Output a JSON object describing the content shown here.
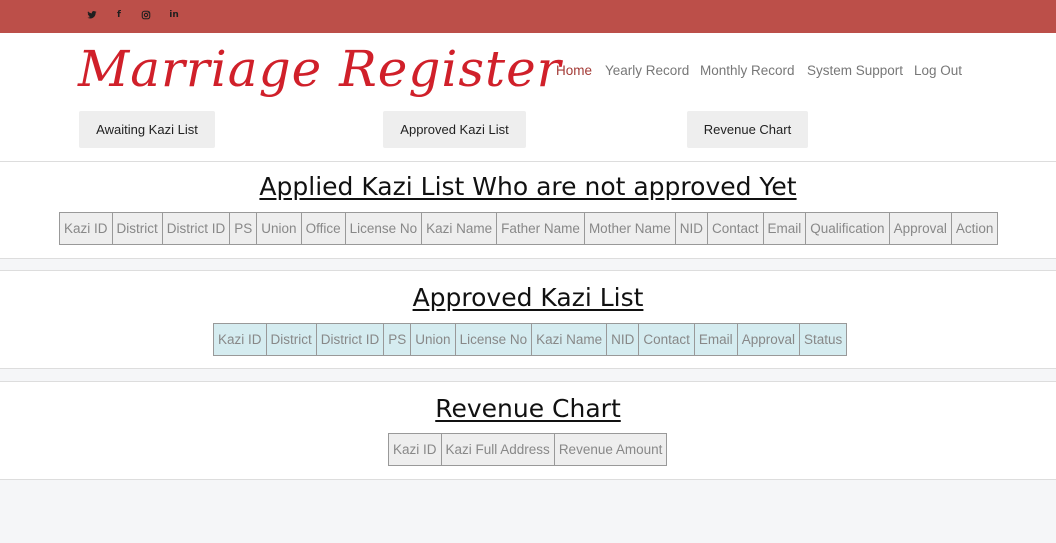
{
  "social": {
    "twitter": "twitter-icon",
    "facebook": "f",
    "instagram": "instagram-icon",
    "linkedin": "in"
  },
  "brand": {
    "logo_text": "Marriage Register"
  },
  "nav": {
    "home": "Home",
    "yearly": "Yearly Record",
    "monthly": "Monthly Record",
    "support": "System Support",
    "logout": "Log Out"
  },
  "buttons": {
    "awaiting": "Awaiting Kazi List",
    "approved": "Approved Kazi List",
    "revenue": "Revenue Chart"
  },
  "applied": {
    "title": "Applied Kazi List Who are not approved Yet",
    "columns": [
      "Kazi ID",
      "District",
      "District ID",
      "PS",
      "Union",
      "Office",
      "License No",
      "Kazi Name",
      "Father Name",
      "Mother Name",
      "NID",
      "Contact",
      "Email",
      "Qualification",
      "Approval",
      "Action"
    ]
  },
  "approved": {
    "title": "Approved Kazi List",
    "columns": [
      "Kazi ID",
      "District",
      "District ID",
      "PS",
      "Union",
      "License No",
      "Kazi Name",
      "NID",
      "Contact",
      "Email",
      "Approval",
      "Status"
    ]
  },
  "revenue": {
    "title": "Revenue Chart",
    "columns": [
      "Kazi ID",
      "Kazi Full Address",
      "Revenue Amount"
    ]
  },
  "colors": {
    "topbar": "#bc4f49",
    "logo": "#d0202a",
    "nav_active": "#a33a36",
    "approved_header_bg": "#d5ecf0"
  }
}
